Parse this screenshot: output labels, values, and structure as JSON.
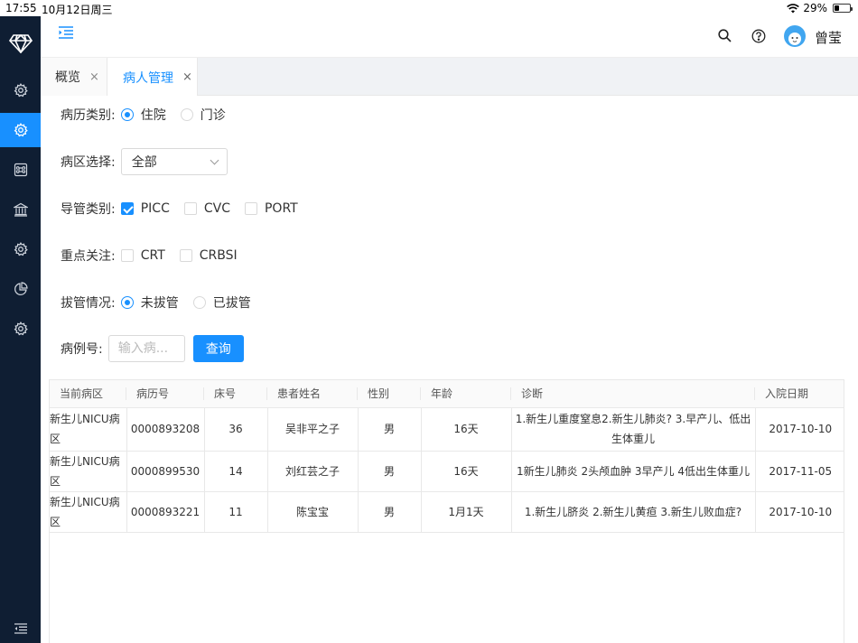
{
  "status": {
    "time": "17:55",
    "date": "10月12日周三",
    "battery": "29%",
    "battery_level": 0.29
  },
  "header": {
    "username": "曾莹"
  },
  "tabs": [
    {
      "label": "概览",
      "close": "×"
    },
    {
      "label": "病人管理",
      "close": "×"
    }
  ],
  "form": {
    "record_type": {
      "label": "病历类别:",
      "options": [
        "住院",
        "门诊"
      ],
      "selected": "住院"
    },
    "ward": {
      "label": "病区选择:",
      "value": "全部"
    },
    "catheter": {
      "label": "导管类别:",
      "options": [
        "PICC",
        "CVC",
        "PORT"
      ],
      "checked": [
        "PICC"
      ]
    },
    "focus": {
      "label": "重点关注:",
      "options": [
        "CRT",
        "CRBSI"
      ],
      "checked": []
    },
    "extubation": {
      "label": "拔管情况:",
      "options": [
        "未拔管",
        "已拔管"
      ],
      "selected": "未拔管"
    },
    "case_no": {
      "label": "病例号:",
      "placeholder": "输入病...",
      "value": ""
    },
    "query_label": "查询"
  },
  "table": {
    "columns": [
      "当前病区",
      "病历号",
      "床号",
      "患者姓名",
      "性别",
      "年龄",
      "诊断",
      "入院日期"
    ],
    "rows": [
      [
        "新生儿NICU病区",
        "0000893208",
        "36",
        "吴非平之子",
        "男",
        "16天",
        "1.新生儿重度窒息2.新生儿肺炎? 3.早产儿、低出生体重儿",
        "2017-10-10"
      ],
      [
        "新生儿NICU病区",
        "0000899530",
        "14",
        "刘红芸之子",
        "男",
        "16天",
        "1新生儿肺炎 2头颅血肿 3早产儿 4低出生体重儿",
        "2017-11-05"
      ],
      [
        "新生儿NICU病区",
        "0000893221",
        "11",
        "陈宝宝",
        "男",
        "1月1天",
        "1.新生儿脐炎 2.新生儿黄疸 3.新生儿败血症?",
        "2017-10-10"
      ]
    ]
  },
  "colors": {
    "sidebar": "#0f1e33",
    "accent": "#1890ff"
  },
  "icons": {
    "sidebar": [
      "diamond-logo-icon",
      "gear-icon",
      "gear-icon",
      "command-icon",
      "bank-icon",
      "gear-icon",
      "pie-chart-icon",
      "gear-icon",
      "menu-fold-icon"
    ],
    "header": [
      "menu-unfold-icon",
      "search-icon",
      "help-icon",
      "avatar"
    ]
  }
}
